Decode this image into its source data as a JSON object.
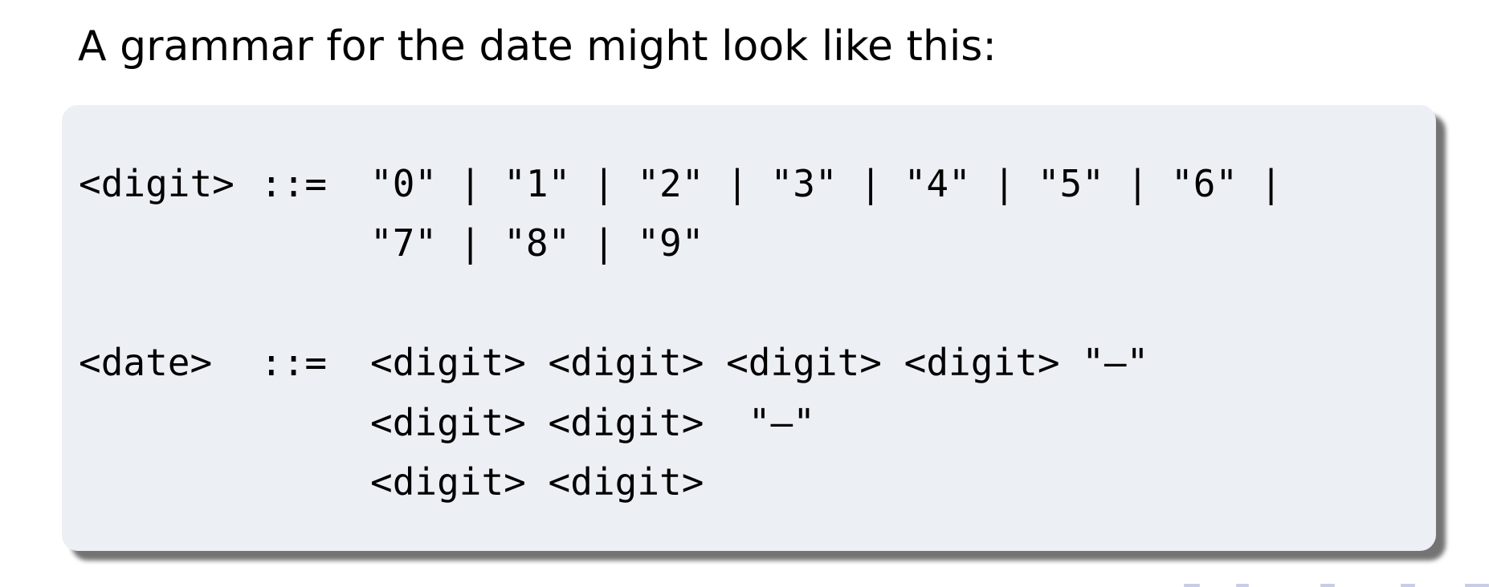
{
  "intro_text": "A grammar for the date might look like this:",
  "grammar": {
    "digit_rule": {
      "lhs": "<digit>",
      "op": "::=",
      "line1": "\"0\" | \"1\" | \"2\" | \"3\" | \"4\" | \"5\" | \"6\" |",
      "line2": "\"7\" | \"8\" | \"9\""
    },
    "date_rule": {
      "lhs": "<date>",
      "op": "::=",
      "line1": "<digit> <digit> <digit> <digit> \"—\"",
      "line2": "<digit> <digit>  \"—\"",
      "line3": "<digit> <digit>"
    }
  },
  "colors": {
    "code_background": "#eceff4",
    "nav_symbols": "#c8cde8"
  }
}
